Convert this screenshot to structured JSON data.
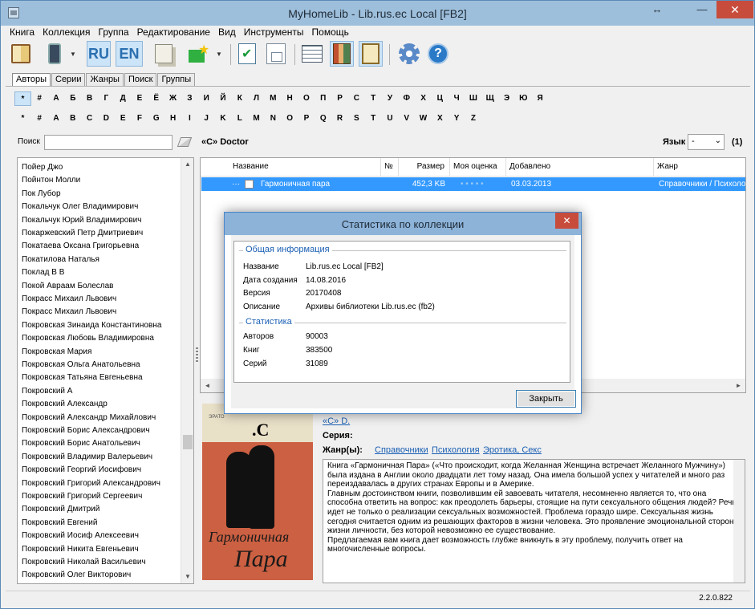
{
  "window": {
    "title": "MyHomeLib - Lib.rus.ec Local [FB2]",
    "resize_glyph": "↔",
    "minimize_glyph": "—",
    "close_glyph": "✕"
  },
  "menu": [
    "Книга",
    "Коллекция",
    "Группа",
    "Редактирование",
    "Вид",
    "Инструменты",
    "Помощь"
  ],
  "toolbar": {
    "lang_ru": "RU",
    "lang_en": "EN",
    "dropdown_glyph": "▼",
    "help_glyph": "?"
  },
  "tabs": [
    "Авторы",
    "Серии",
    "Жанры",
    "Поиск",
    "Группы"
  ],
  "alphabet": {
    "row1": [
      "*",
      "#",
      "А",
      "Б",
      "В",
      "Г",
      "Д",
      "Е",
      "Ё",
      "Ж",
      "З",
      "И",
      "Й",
      "К",
      "Л",
      "М",
      "Н",
      "О",
      "П",
      "Р",
      "С",
      "Т",
      "У",
      "Ф",
      "Х",
      "Ц",
      "Ч",
      "Ш",
      "Щ",
      "Э",
      "Ю",
      "Я"
    ],
    "row2": [
      "*",
      "#",
      "A",
      "B",
      "C",
      "D",
      "E",
      "F",
      "G",
      "H",
      "I",
      "J",
      "K",
      "L",
      "M",
      "N",
      "O",
      "P",
      "Q",
      "R",
      "S",
      "T",
      "U",
      "V",
      "W",
      "X",
      "Y",
      "Z"
    ]
  },
  "search": {
    "label": "Поиск",
    "value": ""
  },
  "authors": [
    "Пойер Джо",
    "Пойнтон Молли",
    "Пок Лубор",
    "Покальчук Олег Владимирович",
    "Покальчук Юрий Владимирович",
    "Покаржевский Петр Дмитриевич",
    "Покатаева Оксана Григорьевна",
    "Покатилова Наталья",
    "Поклад В В",
    "Покой Авраам Болеслав",
    "Покрасс Михаил Львович",
    "Покрасс Михаил Львович",
    "Покровская Зинаида Константиновна",
    "Покровская Любовь Владимировна",
    "Покровская Мария",
    "Покровская Ольга Анатольевна",
    "Покровская Татьяна Евгеньевна",
    "Покровский А",
    "Покровский Александр",
    "Покровский Александр Михайлович",
    "Покровский Борис Александрович",
    "Покровский Борис Анатольевич",
    "Покровский Владимир Валерьевич",
    "Покровский Георгий Иосифович",
    "Покровский Григорий Александрович",
    "Покровский Григорий Сергеевич",
    "Покровский Дмитрий",
    "Покровский Евгений",
    "Покровский Иосиф Алексеевич",
    "Покровский Никита Евгеньевич",
    "Покровский Николай Васильевич",
    "Покровский Олег Викторович"
  ],
  "scroll": {
    "up": "▲",
    "down": "▼",
    "left": "◄",
    "right": "►"
  },
  "selected_author": "«С» Doctor",
  "language_filter": {
    "label": "Язык",
    "value": "-",
    "arrow": "⌄"
  },
  "book_count": "(1)",
  "columns": [
    "Название",
    "№",
    "Размер",
    "Моя оценка",
    "Добавлено",
    "Жанр"
  ],
  "book": {
    "expander": "···",
    "title": "Гармоничная пара",
    "number": "",
    "size": "452,3 KB",
    "rating": "• • • • •",
    "added": "03.03.2013",
    "genre": "Справочники / Психология"
  },
  "cover": {
    "brand": "ЭРАТО",
    "letter": ".С",
    "title_top": "Гармоничная",
    "title_bottom": "Пара"
  },
  "details": {
    "author_link": "«С» D.",
    "series_label": "Серия:",
    "genre_label": "Жанр(ы):",
    "genre_links": [
      "Справочники",
      "Психология",
      "Эротика, Секс"
    ],
    "annotation": [
      "Книга «Гармоничная Пара» («Что происходит, когда Желанная Женщина встречает Желанного Мужчину») была издана в Англии около двадцати лет тому назад. Она имела большой успех у читателей и много раз переиздавалась в других странах Европы и в Америке.",
      "Главным достоинством книги, позволившим ей завоевать читателя, несомненно является то, что она способна ответить на вопрос: как преодолеть барьеры, стоящие на пути сексуального общения людей? Речь идет не только о реализации сексуальных возможностей. Проблема гораздо шире. Сексуальная жизнь сегодня считается одним из решающих факторов в жизни человека. Это проявление эмоциональной стороны жизни личности, без которой невозможно ее существование.",
      "Предлагаемая вам книга дает возможность глубже вникнуть в эту проблему, получить ответ на многочисленные вопросы."
    ]
  },
  "status": {
    "version": "2.2.0.822"
  },
  "dialog": {
    "title": "Статистика по коллекции",
    "close_glyph": "✕",
    "general_title": "Общая информация",
    "general": [
      {
        "label": "Название",
        "value": "Lib.rus.ec Local [FB2]"
      },
      {
        "label": "Дата создания",
        "value": "14.08.2016"
      },
      {
        "label": "Версия",
        "value": "20170408"
      },
      {
        "label": "Описание",
        "value": "Архивы библиотеки Lib.rus.ec (fb2)"
      }
    ],
    "stats_title": "Статистика",
    "stats": [
      {
        "label": "Авторов",
        "value": "90003"
      },
      {
        "label": "Книг",
        "value": "383500"
      },
      {
        "label": "Серий",
        "value": "31089"
      }
    ],
    "close_button": "Закрыть"
  }
}
